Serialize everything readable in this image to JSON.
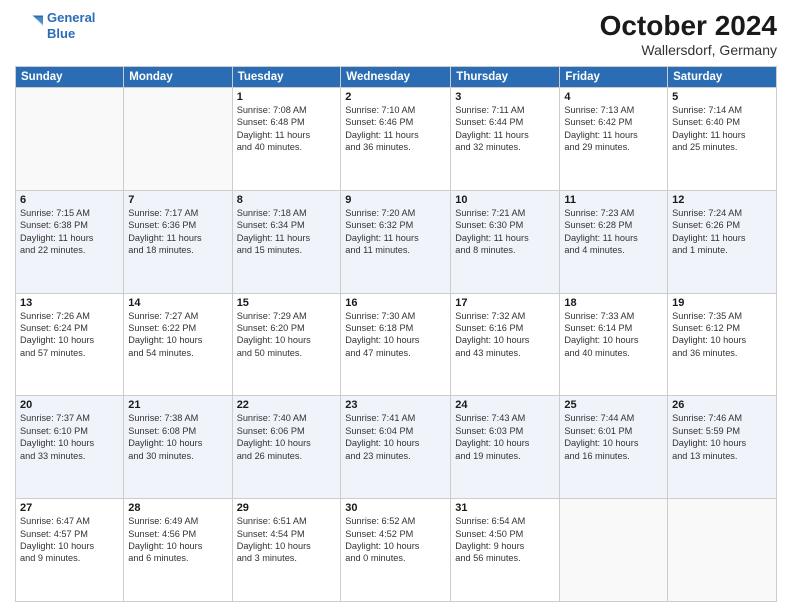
{
  "header": {
    "logo_line1": "General",
    "logo_line2": "Blue",
    "month": "October 2024",
    "location": "Wallersdorf, Germany"
  },
  "weekdays": [
    "Sunday",
    "Monday",
    "Tuesday",
    "Wednesday",
    "Thursday",
    "Friday",
    "Saturday"
  ],
  "weeks": [
    [
      {
        "day": "",
        "detail": ""
      },
      {
        "day": "",
        "detail": ""
      },
      {
        "day": "1",
        "detail": "Sunrise: 7:08 AM\nSunset: 6:48 PM\nDaylight: 11 hours\nand 40 minutes."
      },
      {
        "day": "2",
        "detail": "Sunrise: 7:10 AM\nSunset: 6:46 PM\nDaylight: 11 hours\nand 36 minutes."
      },
      {
        "day": "3",
        "detail": "Sunrise: 7:11 AM\nSunset: 6:44 PM\nDaylight: 11 hours\nand 32 minutes."
      },
      {
        "day": "4",
        "detail": "Sunrise: 7:13 AM\nSunset: 6:42 PM\nDaylight: 11 hours\nand 29 minutes."
      },
      {
        "day": "5",
        "detail": "Sunrise: 7:14 AM\nSunset: 6:40 PM\nDaylight: 11 hours\nand 25 minutes."
      }
    ],
    [
      {
        "day": "6",
        "detail": "Sunrise: 7:15 AM\nSunset: 6:38 PM\nDaylight: 11 hours\nand 22 minutes."
      },
      {
        "day": "7",
        "detail": "Sunrise: 7:17 AM\nSunset: 6:36 PM\nDaylight: 11 hours\nand 18 minutes."
      },
      {
        "day": "8",
        "detail": "Sunrise: 7:18 AM\nSunset: 6:34 PM\nDaylight: 11 hours\nand 15 minutes."
      },
      {
        "day": "9",
        "detail": "Sunrise: 7:20 AM\nSunset: 6:32 PM\nDaylight: 11 hours\nand 11 minutes."
      },
      {
        "day": "10",
        "detail": "Sunrise: 7:21 AM\nSunset: 6:30 PM\nDaylight: 11 hours\nand 8 minutes."
      },
      {
        "day": "11",
        "detail": "Sunrise: 7:23 AM\nSunset: 6:28 PM\nDaylight: 11 hours\nand 4 minutes."
      },
      {
        "day": "12",
        "detail": "Sunrise: 7:24 AM\nSunset: 6:26 PM\nDaylight: 11 hours\nand 1 minute."
      }
    ],
    [
      {
        "day": "13",
        "detail": "Sunrise: 7:26 AM\nSunset: 6:24 PM\nDaylight: 10 hours\nand 57 minutes."
      },
      {
        "day": "14",
        "detail": "Sunrise: 7:27 AM\nSunset: 6:22 PM\nDaylight: 10 hours\nand 54 minutes."
      },
      {
        "day": "15",
        "detail": "Sunrise: 7:29 AM\nSunset: 6:20 PM\nDaylight: 10 hours\nand 50 minutes."
      },
      {
        "day": "16",
        "detail": "Sunrise: 7:30 AM\nSunset: 6:18 PM\nDaylight: 10 hours\nand 47 minutes."
      },
      {
        "day": "17",
        "detail": "Sunrise: 7:32 AM\nSunset: 6:16 PM\nDaylight: 10 hours\nand 43 minutes."
      },
      {
        "day": "18",
        "detail": "Sunrise: 7:33 AM\nSunset: 6:14 PM\nDaylight: 10 hours\nand 40 minutes."
      },
      {
        "day": "19",
        "detail": "Sunrise: 7:35 AM\nSunset: 6:12 PM\nDaylight: 10 hours\nand 36 minutes."
      }
    ],
    [
      {
        "day": "20",
        "detail": "Sunrise: 7:37 AM\nSunset: 6:10 PM\nDaylight: 10 hours\nand 33 minutes."
      },
      {
        "day": "21",
        "detail": "Sunrise: 7:38 AM\nSunset: 6:08 PM\nDaylight: 10 hours\nand 30 minutes."
      },
      {
        "day": "22",
        "detail": "Sunrise: 7:40 AM\nSunset: 6:06 PM\nDaylight: 10 hours\nand 26 minutes."
      },
      {
        "day": "23",
        "detail": "Sunrise: 7:41 AM\nSunset: 6:04 PM\nDaylight: 10 hours\nand 23 minutes."
      },
      {
        "day": "24",
        "detail": "Sunrise: 7:43 AM\nSunset: 6:03 PM\nDaylight: 10 hours\nand 19 minutes."
      },
      {
        "day": "25",
        "detail": "Sunrise: 7:44 AM\nSunset: 6:01 PM\nDaylight: 10 hours\nand 16 minutes."
      },
      {
        "day": "26",
        "detail": "Sunrise: 7:46 AM\nSunset: 5:59 PM\nDaylight: 10 hours\nand 13 minutes."
      }
    ],
    [
      {
        "day": "27",
        "detail": "Sunrise: 6:47 AM\nSunset: 4:57 PM\nDaylight: 10 hours\nand 9 minutes."
      },
      {
        "day": "28",
        "detail": "Sunrise: 6:49 AM\nSunset: 4:56 PM\nDaylight: 10 hours\nand 6 minutes."
      },
      {
        "day": "29",
        "detail": "Sunrise: 6:51 AM\nSunset: 4:54 PM\nDaylight: 10 hours\nand 3 minutes."
      },
      {
        "day": "30",
        "detail": "Sunrise: 6:52 AM\nSunset: 4:52 PM\nDaylight: 10 hours\nand 0 minutes."
      },
      {
        "day": "31",
        "detail": "Sunrise: 6:54 AM\nSunset: 4:50 PM\nDaylight: 9 hours\nand 56 minutes."
      },
      {
        "day": "",
        "detail": ""
      },
      {
        "day": "",
        "detail": ""
      }
    ]
  ]
}
